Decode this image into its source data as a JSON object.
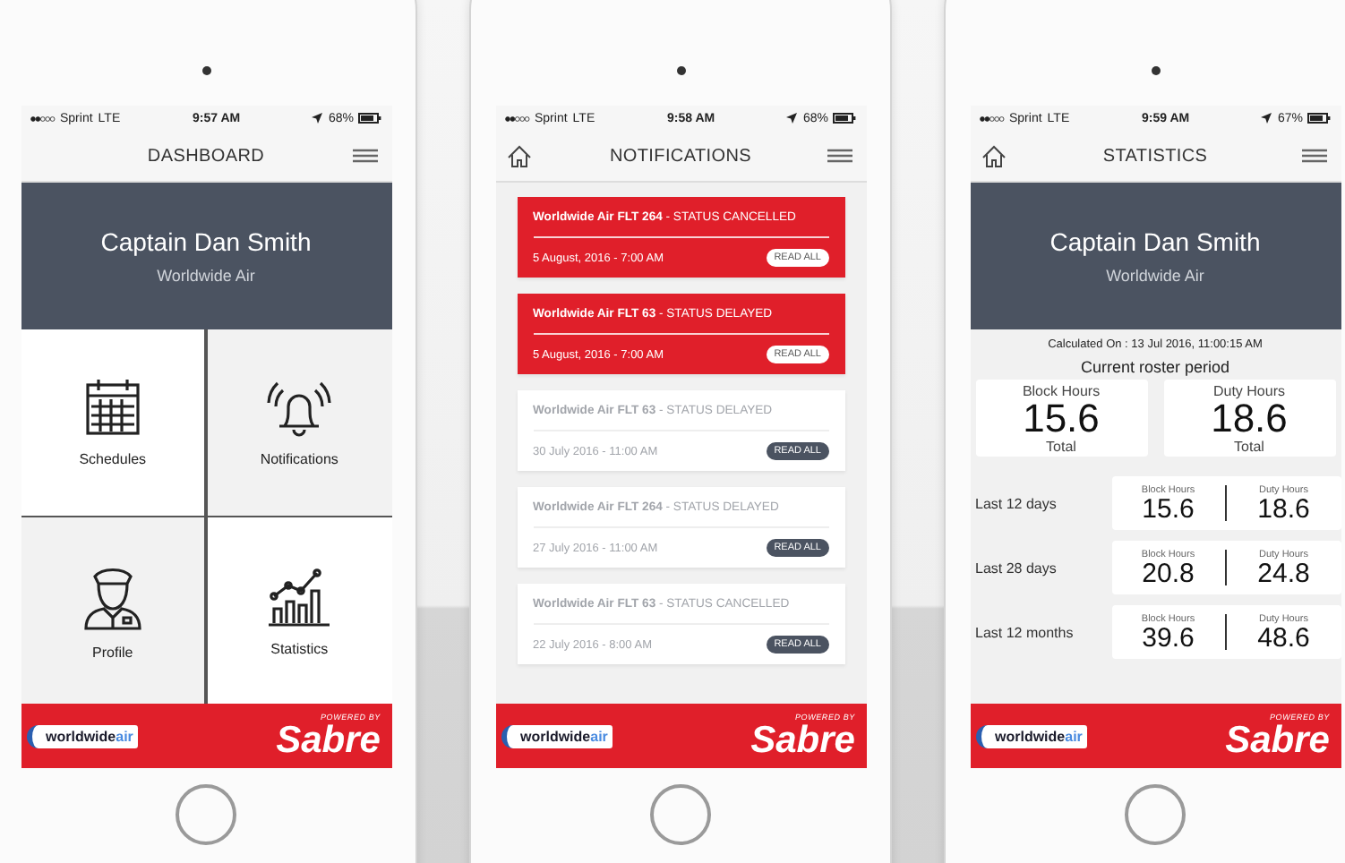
{
  "phones": [
    {
      "kind": "dashboard",
      "show_home": false,
      "status_bar": {
        "carrier": "Sprint",
        "network": "LTE",
        "time": "9:57 AM",
        "battery": "68%"
      },
      "header": {
        "title": "DASHBOARD"
      },
      "profile": {
        "name": "Captain Dan Smith",
        "airline": "Worldwide Air"
      },
      "tiles": [
        {
          "kind": "calendar",
          "label": "Schedules"
        },
        {
          "kind": "bell",
          "label": "Notifications"
        },
        {
          "kind": "pilot",
          "label": "Profile"
        },
        {
          "kind": "chart",
          "label": "Statistics"
        }
      ],
      "footer": {
        "logo": "worldwide",
        "logo_accent": "air",
        "powered_by": "POWERED BY",
        "brand": "Sabre"
      }
    },
    {
      "kind": "notifications",
      "show_home": true,
      "status_bar": {
        "carrier": "Sprint",
        "network": "LTE",
        "time": "9:58 AM",
        "battery": "68%"
      },
      "header": {
        "title": "NOTIFICATIONS"
      },
      "notifications": [
        {
          "title": "**Worldwide Air FLT 264** - STATUS CANCELLED",
          "date": "5 August, 2016 - 7:00 AM",
          "button": "READ ALL",
          "unread": true
        },
        {
          "title": "**Worldwide Air FLT 63** - STATUS DELAYED",
          "date": "5 August, 2016 - 7:00 AM",
          "button": "READ ALL",
          "unread": true
        },
        {
          "title": "**Worldwide Air FLT 63** - STATUS DELAYED",
          "date": "30 July 2016 - 11:00 AM",
          "button": "READ ALL",
          "unread": false
        },
        {
          "title": "**Worldwide Air FLT 264** - STATUS DELAYED",
          "date": "27 July 2016 - 11:00 AM",
          "button": "READ ALL",
          "unread": false
        },
        {
          "title": "**Worldwide Air FLT 63** - STATUS CANCELLED",
          "date": "22 July 2016 - 8:00 AM",
          "button": "READ ALL",
          "unread": false
        }
      ],
      "footer": {
        "logo": "worldwide",
        "logo_accent": "air",
        "powered_by": "POWERED BY",
        "brand": "Sabre"
      }
    },
    {
      "kind": "statistics",
      "show_home": true,
      "status_bar": {
        "carrier": "Sprint",
        "network": "LTE",
        "time": "9:59 AM",
        "battery": "67%"
      },
      "header": {
        "title": "STATISTICS"
      },
      "profile": {
        "name": "Captain Dan Smith",
        "airline": "Worldwide Air"
      },
      "calculated": "Calculated On : 13 Jul 2016, 11:00:15 AM",
      "period": "Current roster period",
      "totals": [
        {
          "label": "Block Hours",
          "value": "15.6",
          "caption": "Total"
        },
        {
          "label": "Duty Hours",
          "value": "18.6",
          "caption": "Total"
        }
      ],
      "rows": [
        {
          "period": "Last 12 days",
          "block_label": "Block Hours",
          "block": "15.6",
          "duty_label": "Duty Hours",
          "duty": "18.6"
        },
        {
          "period": "Last 28 days",
          "block_label": "Block Hours",
          "block": "20.8",
          "duty_label": "Duty Hours",
          "duty": "24.8"
        },
        {
          "period": "Last 12 months",
          "block_label": "Block Hours",
          "block": "39.6",
          "duty_label": "Duty Hours",
          "duty": "48.6"
        }
      ],
      "footer": {
        "logo": "worldwide",
        "logo_accent": "air",
        "powered_by": "POWERED BY",
        "brand": "Sabre"
      }
    }
  ]
}
